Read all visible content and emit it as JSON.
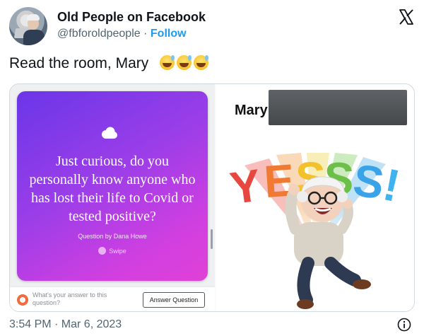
{
  "account": {
    "name": "Old People on Facebook",
    "handle": "@fbforoldpeople",
    "separator": "·",
    "follow_label": "Follow"
  },
  "tweet": {
    "text": "Read the room, Mary",
    "emojis": [
      "grinning-sweat-emoji",
      "grinning-sweat-emoji",
      "grinning-sweat-emoji"
    ]
  },
  "media": {
    "story": {
      "question": "Just curious, do you personally know anyone who has lost their life to Covid or tested positive?",
      "question_by": "Question by Dana Howe",
      "swipe_label": "Swipe",
      "answer_prompt": "What's your answer to this question?",
      "answer_button": "Answer Question"
    },
    "meme": {
      "name": "Mary",
      "sticker_text": "YESSS!"
    }
  },
  "footer": {
    "timestamp": "3:54 PM · Mar 6, 2023"
  },
  "colors": {
    "follow": "#1d9bf0",
    "text_secondary": "#536471",
    "card_gradient_start": "#6a36e8",
    "card_gradient_end": "#e041d6"
  }
}
